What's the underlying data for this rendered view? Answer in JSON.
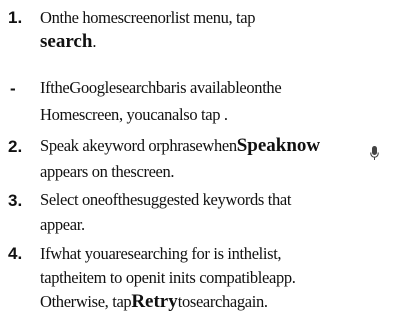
{
  "steps": [
    {
      "marker": "1.",
      "lines": [
        "Onthe homescreenorlist menu, tap",
        ""
      ],
      "bold": "search",
      "after_bold": "."
    },
    {
      "marker": "-",
      "lines": [
        "IftheGooglesearchbaris availableonthe",
        "Homescreen, youcanalso tap ."
      ]
    },
    {
      "marker": "2.",
      "before_bold": "Speak akeyword orphrasewhen",
      "bold": "Speaknow",
      "lines": [
        "",
        "appears on thescreen."
      ]
    },
    {
      "marker": "3.",
      "lines": [
        "Select oneofthesuggested keywords that",
        "appear."
      ]
    },
    {
      "marker": "4.",
      "lines": [
        "Ifwhat youaresearching for is inthelist,",
        "taptheitem to openit inits compatibleapp."
      ],
      "before_bold": "Otherwise, tap",
      "bold": "Retry",
      "after_bold": "tosearchagain."
    }
  ],
  "icons": {
    "mic": "microphone-icon"
  }
}
